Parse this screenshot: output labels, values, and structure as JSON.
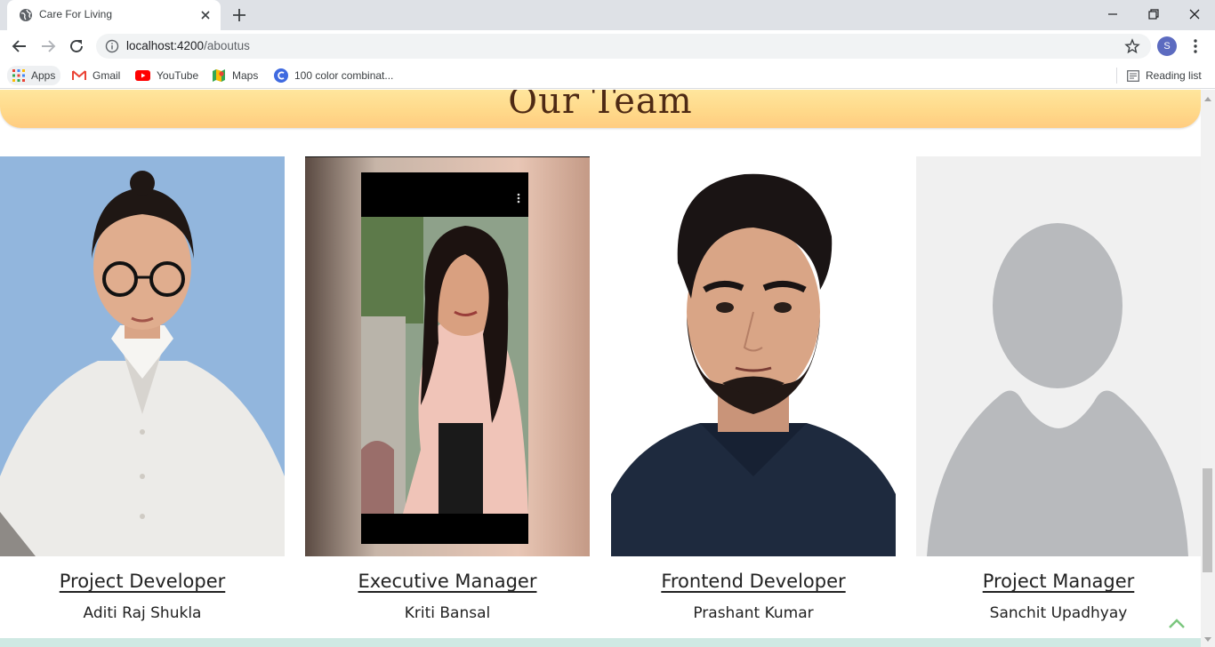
{
  "browser": {
    "tab_title": "Care For Living",
    "url_host": "localhost:4200",
    "url_path": "/aboutus",
    "profile_initial": "S",
    "bookmarks": [
      {
        "label": "Apps",
        "icon": "apps-grid-icon"
      },
      {
        "label": "Gmail",
        "icon": "gmail-icon"
      },
      {
        "label": "YouTube",
        "icon": "youtube-icon"
      },
      {
        "label": "Maps",
        "icon": "maps-icon"
      },
      {
        "label": "100 color combinat...",
        "icon": "site-c-icon"
      }
    ],
    "reading_list": "Reading list"
  },
  "page": {
    "section_title": "Our Team",
    "members": [
      {
        "role": "Project Developer",
        "name": "Aditi Raj Shukla",
        "photo": "photo-woman-glasses"
      },
      {
        "role": "Executive Manager",
        "name": "Kriti Bansal",
        "photo": "photo-woman-phone-screenshot"
      },
      {
        "role": "Frontend Developer",
        "name": "Prashant Kumar",
        "photo": "photo-man-beard"
      },
      {
        "role": "Project Manager",
        "name": "Sanchit Upadhyay",
        "photo": "placeholder-avatar"
      }
    ]
  },
  "colors": {
    "banner_gradient_top": "#ffe8a0",
    "banner_gradient_bottom": "#ffcc80",
    "title_color": "#4e2a14",
    "footer_strip": "#cfe9e3",
    "back_to_top": "#7bc67e"
  }
}
